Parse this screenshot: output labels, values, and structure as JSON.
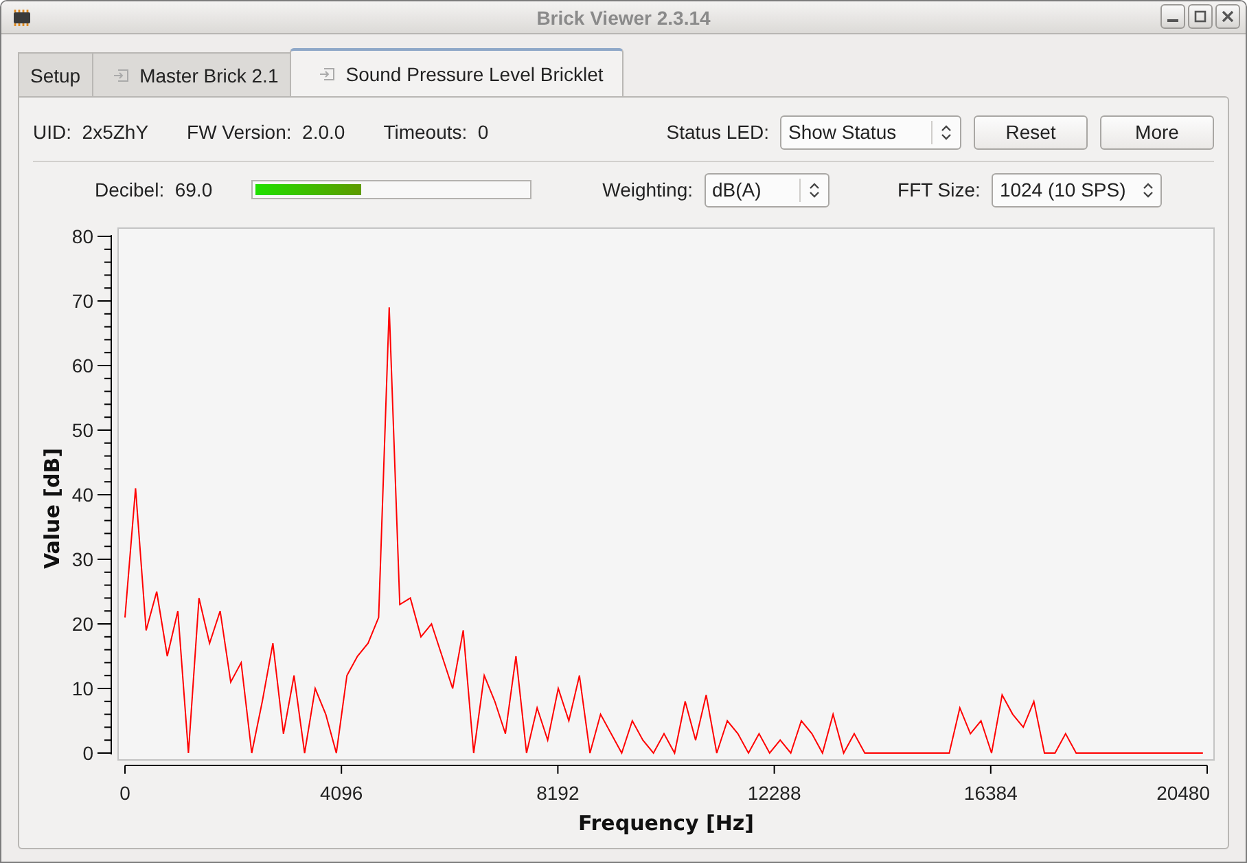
{
  "window": {
    "title": "Brick Viewer 2.3.14"
  },
  "tabs": [
    {
      "label": "Setup",
      "kind": "plain",
      "selected": false
    },
    {
      "label": "Master Brick 2.1",
      "kind": "device",
      "selected": false
    },
    {
      "label": "Sound Pressure Level Bricklet",
      "kind": "device",
      "selected": true
    }
  ],
  "info": [
    {
      "label": "UID:",
      "value": "2x5ZhY"
    },
    {
      "label": "FW Version:",
      "value": "2.0.0"
    },
    {
      "label": "Timeouts:",
      "value": "0"
    }
  ],
  "status_led": {
    "label": "Status LED:",
    "value": "Show Status"
  },
  "buttons": [
    "Reset",
    "More"
  ],
  "decibel": {
    "label": "Decibel:",
    "value": "69.0",
    "level": 0.39
  },
  "weighting": {
    "label": "Weighting:",
    "value": "dB(A)"
  },
  "fft_size": {
    "label": "FFT Size:",
    "value": "1024 (10 SPS)"
  },
  "chart_data": {
    "type": "line",
    "xlabel": "Frequency [Hz]",
    "ylabel": "Value [dB]",
    "xlim": [
      0,
      20480
    ],
    "ylim": [
      0,
      80
    ],
    "xticks": [
      0,
      4096,
      8192,
      12288,
      16384,
      20480
    ],
    "yticks": [
      0,
      10,
      20,
      30,
      40,
      50,
      60,
      70,
      80
    ],
    "x": [
      0,
      200,
      400,
      600,
      800,
      1000,
      1200,
      1400,
      1600,
      1800,
      2000,
      2200,
      2400,
      2600,
      2800,
      3000,
      3200,
      3400,
      3600,
      3800,
      4000,
      4200,
      4400,
      4600,
      4800,
      5000,
      5200,
      5400,
      5600,
      5800,
      6000,
      6200,
      6400,
      6600,
      6800,
      7000,
      7200,
      7400,
      7600,
      7800,
      8000,
      8200,
      8400,
      8600,
      8800,
      9000,
      9200,
      9400,
      9600,
      9800,
      10000,
      10200,
      10400,
      10600,
      10800,
      11000,
      11200,
      11400,
      11600,
      11800,
      12000,
      12200,
      12400,
      12600,
      12800,
      13000,
      13200,
      13400,
      13600,
      13800,
      14000,
      14200,
      14400,
      14600,
      14800,
      15000,
      15200,
      15400,
      15600,
      15800,
      16000,
      16200,
      16400,
      16600,
      16800,
      17000,
      17200,
      17400,
      17600,
      17800,
      18000,
      18200,
      18400,
      18600,
      18800,
      19000,
      19200,
      19400,
      19600,
      19800,
      20000,
      20200,
      20400
    ],
    "series": [
      {
        "color": "#ff0000",
        "values": [
          21,
          41,
          19,
          25,
          15,
          22,
          0,
          24,
          17,
          22,
          11,
          14,
          0,
          8,
          17,
          3,
          12,
          0,
          10,
          6,
          0,
          12,
          15,
          17,
          21,
          69,
          23,
          24,
          18,
          20,
          15,
          10,
          19,
          0,
          12,
          8,
          3,
          15,
          0,
          7,
          2,
          10,
          5,
          12,
          0,
          6,
          3,
          0,
          5,
          2,
          0,
          3,
          0,
          8,
          2,
          9,
          0,
          5,
          3,
          0,
          3,
          0,
          2,
          0,
          5,
          3,
          0,
          6,
          0,
          3,
          0,
          0,
          0,
          0,
          0,
          0,
          0,
          0,
          0,
          7,
          3,
          5,
          0,
          9,
          6,
          4,
          8,
          0,
          0,
          3,
          0,
          0,
          0,
          0,
          0,
          0,
          0,
          0,
          0,
          0,
          0,
          0,
          0
        ]
      }
    ]
  }
}
